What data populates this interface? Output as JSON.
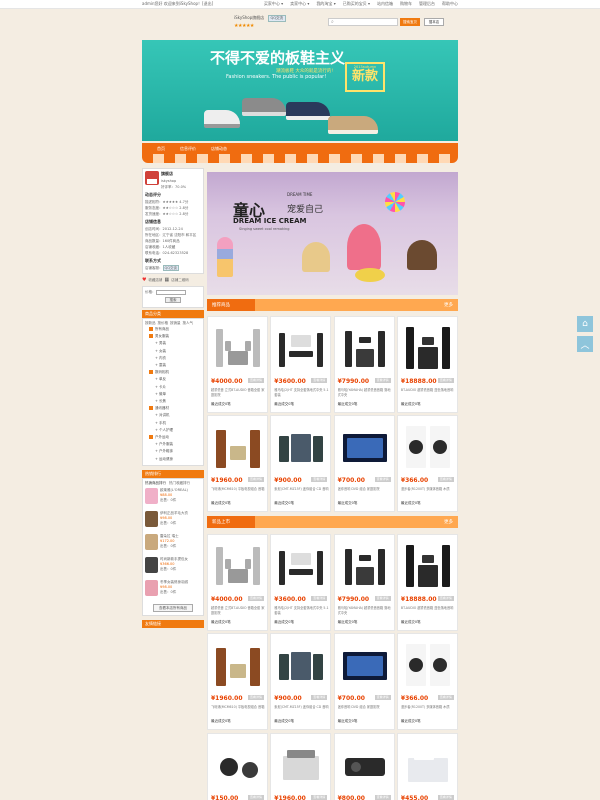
{
  "topbar": {
    "welcome": "admin您好 欢迎来到iSkyShop！[退出]",
    "links": [
      "买家中心 ▾",
      "卖家中心 ▾",
      "我的淘宝 ▾",
      "已购买的宝贝 ▾",
      "站内信箱",
      "购物车",
      "管理后台",
      "帮助中心"
    ]
  },
  "shop": {
    "name": "iSkyShop旗舰店",
    "qq": "QQ交流",
    "stars": "★★★★★"
  },
  "search": {
    "placeholder": "",
    "btn_shop": "搜索宝贝",
    "btn_all": "搜本店"
  },
  "banner": {
    "title": "不得不爱的板鞋主义",
    "sub_cn": "潮流板鞋 大众的就是流行的!",
    "sub_en": "Fashion sneakers. The public is popular!",
    "year": "2013autumn",
    "new": "新款"
  },
  "nav": {
    "items": [
      "首页",
      "信息评价",
      "店铺动态"
    ]
  },
  "sidebar": {
    "title": "旗舰店",
    "seller": "iskyshop",
    "rep": "好评率：70.0%",
    "rating_title": "动态评分",
    "ratings": [
      "描述相符：★★★★★ 4.7分",
      "服务态度：★★☆☆☆ 2.8分",
      "发货速度：★★☆☆☆ 2.8分"
    ],
    "info_title": "店铺信息",
    "info": [
      "创店时间：2012-12-24",
      "所在地区：辽宁省 沈阳市 和平区",
      "商品数量：160件商品",
      "店铺收藏：1人收藏",
      "联系电话：024-62323528"
    ],
    "contact_title": "联系方式",
    "contact": "店铺客服：",
    "contact_qq": "QQ交谈",
    "collect": "收藏店铺",
    "qrcode": "店铺二维码",
    "search_label": "价格：",
    "search_btn": "搜索",
    "cat_title": "商品分类",
    "cat_tabs": [
      "按新品",
      "按价格",
      "按销量",
      "按人气"
    ],
    "cats": [
      {
        "l": "所有商品",
        "s": false,
        "sq": true
      },
      {
        "l": "男女服装",
        "s": false,
        "sq": true
      },
      {
        "l": "男装",
        "s": true,
        "sq": false
      },
      {
        "l": "女装",
        "s": true,
        "sq": false
      },
      {
        "l": "内衣",
        "s": true,
        "sq": false
      },
      {
        "l": "童装",
        "s": true,
        "sq": false
      },
      {
        "l": "数码相机",
        "s": false,
        "sq": true
      },
      {
        "l": "单反",
        "s": true,
        "sq": false
      },
      {
        "l": "卡片",
        "s": true,
        "sq": false
      },
      {
        "l": "微单",
        "s": true,
        "sq": false
      },
      {
        "l": "长焦",
        "s": true,
        "sq": false
      },
      {
        "l": "通讯器材",
        "s": false,
        "sq": true
      },
      {
        "l": "对讲机",
        "s": true,
        "sq": false
      },
      {
        "l": "手机",
        "s": true,
        "sq": false
      },
      {
        "l": "个人护理",
        "s": true,
        "sq": false
      },
      {
        "l": "户外运动",
        "s": false,
        "sq": true
      },
      {
        "l": "户外服装",
        "s": true,
        "sq": false
      },
      {
        "l": "户外鞋袜",
        "s": true,
        "sq": false
      },
      {
        "l": "运动健身",
        "s": true,
        "sq": false
      }
    ],
    "hot_title": "热销排行",
    "hot_tabs": [
      "热销商品排行",
      "热门收藏排行"
    ],
    "hot": [
      {
        "t": "欧莱雅(L'OREAL)",
        "p": "¥88.00",
        "n": "出售：0件"
      },
      {
        "t": "伊利正品羊毛大衣",
        "p": "¥98.00",
        "n": "出售：0件"
      },
      {
        "t": "雷朵拉 瑞士",
        "p": "¥172.00",
        "n": "出售：0件"
      },
      {
        "t": "时尚新款手提包女",
        "p": "¥366.00",
        "n": "出售：0件"
      },
      {
        "t": "冬季女装修身羽绒",
        "p": "¥98.00",
        "n": "出售：0件"
      }
    ],
    "more": "查看本店所有商品",
    "friend": "友情链接"
  },
  "promo": {
    "title": "童心",
    "dt": "DREAM TIME",
    "subtitle": "宠爱自己",
    "en": "DREAM ICE CREAM",
    "tagline": "Singing sweet cool remaking"
  },
  "sections": [
    {
      "title": "推荐商品",
      "more": "更多"
    },
    {
      "title": "新品上市",
      "more": "更多"
    }
  ],
  "products": [
    {
      "price": "¥4000.00",
      "tag": "查看详情",
      "desc": "超重低音 立式BT-AUDIO 音箱全套 家庭影院",
      "sold": "最近成交0笔",
      "icon": "speaker-set-icon"
    },
    {
      "price": "¥3600.00",
      "tag": "查看详情",
      "desc": "雅马哈(2)HT 支持全套落地式中央 5.1套装",
      "sold": "最近成交0笔",
      "icon": "home-theater-icon"
    },
    {
      "price": "¥7990.00",
      "tag": "查看详情",
      "desc": "雅马哈(YAMAHA) 超重低音音箱 落地式中央",
      "sold": "最近成交0笔",
      "icon": "speaker-pair-icon"
    },
    {
      "price": "¥18888.00",
      "tag": "查看详情",
      "desc": "BT-AUDIO 超重低音箱 蓝色落地音响",
      "sold": "最近成交0笔",
      "icon": "tower-speakers-icon"
    },
    {
      "price": "¥1960.00",
      "tag": "查看详情",
      "desc": "飞利浦(MCM610) 平板电视组合 音箱",
      "sold": "最近成交0笔",
      "icon": "wood-speakers-icon"
    },
    {
      "price": "¥900.00",
      "tag": "查看详情",
      "desc": "索尼(CMT-MZ15F) 迷你组合 CD 音响",
      "sold": "最近成交0笔",
      "icon": "mini-hifi-icon"
    },
    {
      "price": "¥700.00",
      "tag": "查看详情",
      "desc": "迷你音响 DVD 组合 家庭影院",
      "sold": "最近成交0笔",
      "icon": "blue-hifi-icon"
    },
    {
      "price": "¥366.00",
      "tag": "查看详情",
      "desc": "漫步者(R1200T) 多媒体音箱 木质",
      "sold": "最近成交0笔",
      "icon": "panda-speakers-icon"
    }
  ],
  "products2": [
    {
      "price": "¥4000.00",
      "tag": "查看详情",
      "desc": "超重低音 立式BT-AUDIO 音箱全套 家庭影院",
      "sold": "最近成交0笔",
      "icon": "speaker-set-icon"
    },
    {
      "price": "¥3600.00",
      "tag": "查看详情",
      "desc": "雅马哈(2)HT 支持全套落地式中央 5.1套装",
      "sold": "最近成交0笔",
      "icon": "home-theater-icon"
    },
    {
      "price": "¥7990.00",
      "tag": "查看详情",
      "desc": "雅马哈(YAMAHA) 超重低音音箱 落地式中央",
      "sold": "最近成交0笔",
      "icon": "speaker-pair-icon"
    },
    {
      "price": "¥18888.00",
      "tag": "查看详情",
      "desc": "BT-AUDIO 超重低音箱 蓝色落地音响",
      "sold": "最近成交0笔",
      "icon": "tower-speakers-icon"
    },
    {
      "price": "¥1960.00",
      "tag": "查看详情",
      "desc": "飞利浦(MCM610) 平板电视组合 音箱",
      "sold": "最近成交0笔",
      "icon": "wood-speakers-icon"
    },
    {
      "price": "¥900.00",
      "tag": "查看详情",
      "desc": "索尼(CMT-MZ15F) 迷你组合 CD 音响",
      "sold": "最近成交0笔",
      "icon": "mini-hifi-icon"
    },
    {
      "price": "¥700.00",
      "tag": "查看详情",
      "desc": "迷你音响 DVD 组合 家庭影院",
      "sold": "最近成交0笔",
      "icon": "blue-hifi-icon"
    },
    {
      "price": "¥366.00",
      "tag": "查看详情",
      "desc": "漫步者(R1200T) 多媒体音箱 木质",
      "sold": "最近成交0笔",
      "icon": "panda-speakers-icon"
    },
    {
      "price": "¥150.00",
      "tag": "查看详情",
      "desc": "",
      "sold": "",
      "icon": "webcam-icon"
    },
    {
      "price": "¥1960.00",
      "tag": "查看详情",
      "desc": "",
      "sold": "",
      "icon": "printer-icon"
    },
    {
      "price": "¥800.00",
      "tag": "查看详情",
      "desc": "",
      "sold": "",
      "icon": "projector-icon"
    },
    {
      "price": "¥455.00",
      "tag": "查看详情",
      "desc": "",
      "sold": "",
      "icon": "fax-icon"
    }
  ],
  "colors": {
    "accent": "#f06c10",
    "price": "#e84200",
    "banner": "#2bb8aa"
  },
  "float": {
    "home_icon": "home-icon",
    "top_icon": "back-to-top-icon"
  }
}
